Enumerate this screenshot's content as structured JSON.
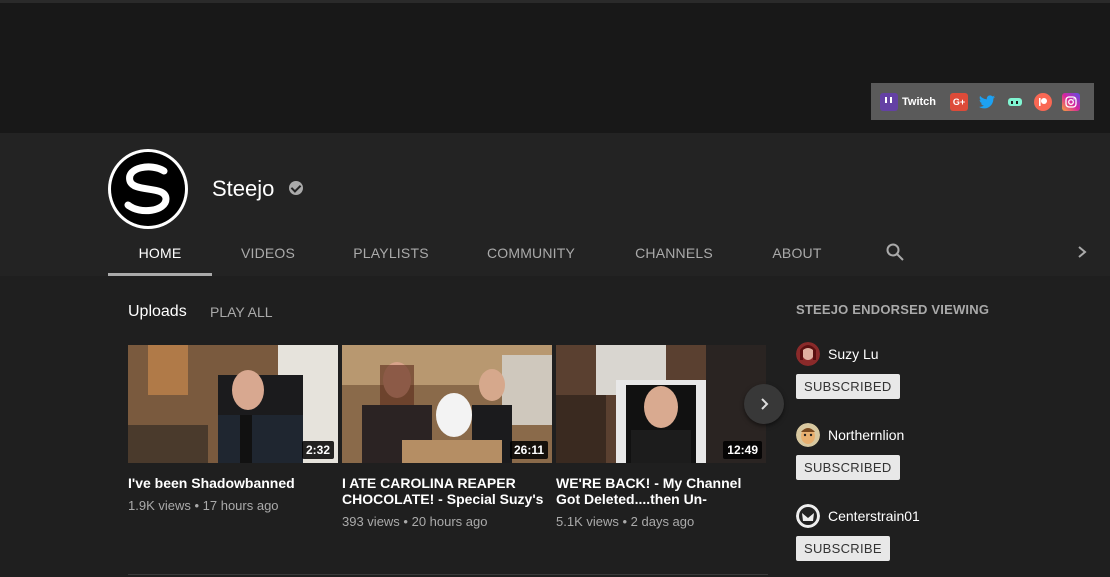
{
  "banner": {
    "twitch_label": "Twitch",
    "social_icons": [
      "google-plus",
      "twitter",
      "streamlabs",
      "patreon",
      "instagram"
    ]
  },
  "channel": {
    "name": "Steejo"
  },
  "tabs": [
    {
      "label": "HOME",
      "active": true
    },
    {
      "label": "VIDEOS"
    },
    {
      "label": "PLAYLISTS"
    },
    {
      "label": "COMMUNITY"
    },
    {
      "label": "CHANNELS"
    },
    {
      "label": "ABOUT"
    }
  ],
  "uploads": {
    "title": "Uploads",
    "play_all": "PLAY ALL",
    "videos": [
      {
        "title": "I've been Shadowbanned",
        "duration": "2:32",
        "meta": "1.9K views • 17 hours ago"
      },
      {
        "title": "I ATE CAROLINA REAPER CHOCOLATE! - Special Suzy's",
        "duration": "26:11",
        "meta": "393 views • 20 hours ago"
      },
      {
        "title": "WE'RE BACK! - My Channel Got Deleted....then Un-",
        "duration": "12:49",
        "meta": "5.1K views • 2 days ago"
      }
    ]
  },
  "sidebar": {
    "title": "STEEJO ENDORSED VIEWING",
    "channels": [
      {
        "name": "Suzy Lu",
        "button": "SUBSCRIBED"
      },
      {
        "name": "Northernlion",
        "button": "SUBSCRIBED"
      },
      {
        "name": "Centerstrain01",
        "button": "SUBSCRIBE"
      }
    ]
  }
}
